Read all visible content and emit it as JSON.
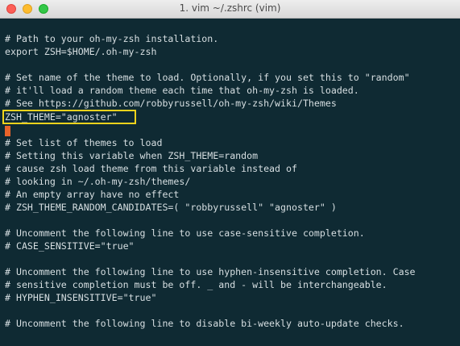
{
  "window": {
    "title": "1. vim ~/.zshrc (vim)"
  },
  "editor": {
    "lines": [
      "",
      "# Path to your oh-my-zsh installation.",
      "export ZSH=$HOME/.oh-my-zsh",
      "",
      "# Set name of the theme to load. Optionally, if you set this to \"random\"",
      "# it'll load a random theme each time that oh-my-zsh is loaded.",
      "# See https://github.com/robbyrussell/oh-my-zsh/wiki/Themes",
      "ZSH_THEME=\"agnoster\"",
      "",
      "",
      "# Set list of themes to load",
      "# Setting this variable when ZSH_THEME=random",
      "# cause zsh load theme from this variable instead of",
      "# looking in ~/.oh-my-zsh/themes/",
      "# An empty array have no effect",
      "# ZSH_THEME_RANDOM_CANDIDATES=( \"robbyrussell\" \"agnoster\" )",
      "",
      "# Uncomment the following line to use case-sensitive completion.",
      "# CASE_SENSITIVE=\"true\"",
      "",
      "# Uncomment the following line to use hyphen-insensitive completion. Case",
      "# sensitive completion must be off. _ and - will be interchangeable.",
      "# HYPHEN_INSENSITIVE=\"true\"",
      "",
      "# Uncomment the following line to disable bi-weekly auto-update checks."
    ]
  },
  "colors": {
    "background": "#0f2a33",
    "text": "#d7dfe2",
    "cursor": "#e8632a",
    "highlight": "#f0d31c"
  }
}
